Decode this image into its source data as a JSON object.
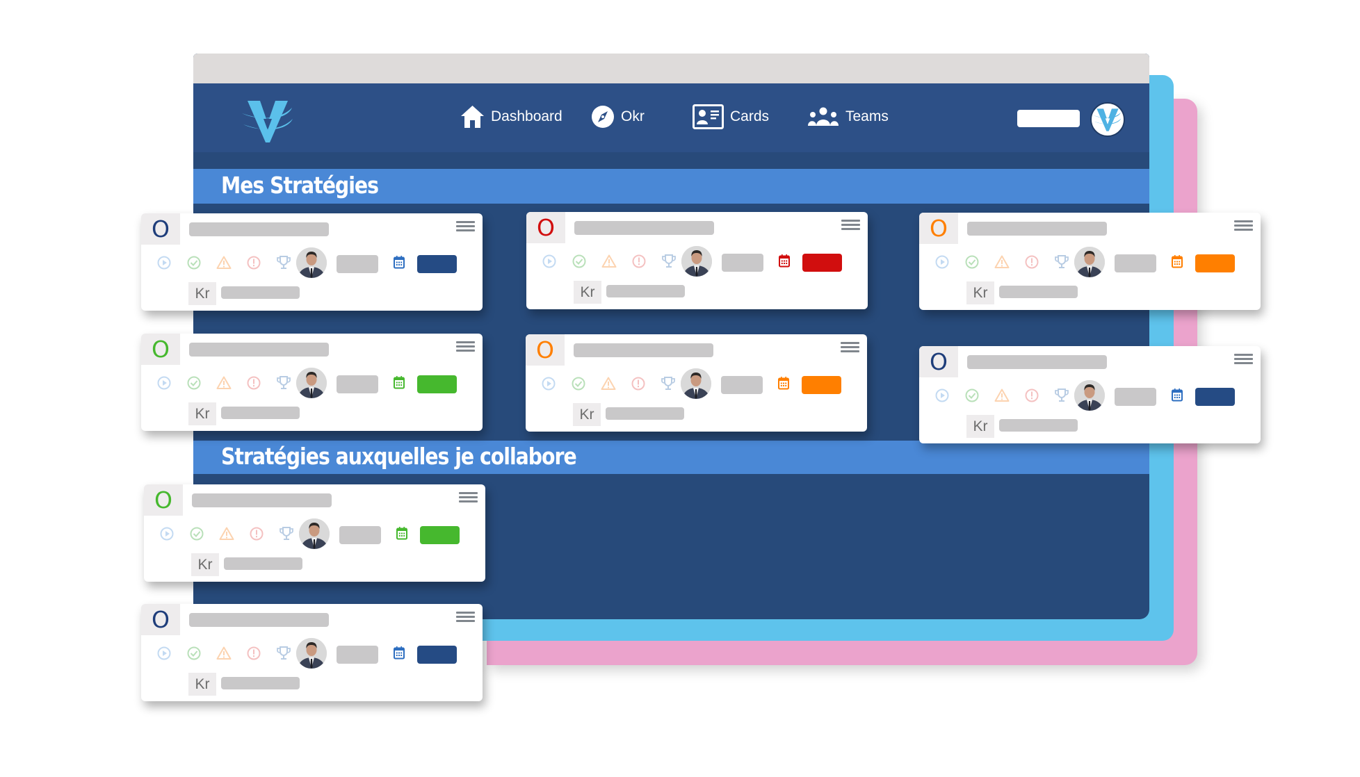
{
  "nav": {
    "items": [
      {
        "label": "Dashboard",
        "icon": "home-icon"
      },
      {
        "label": "Okr",
        "icon": "compass-icon"
      },
      {
        "label": "Cards",
        "icon": "id-card-icon"
      },
      {
        "label": "Teams",
        "icon": "users-icon"
      }
    ],
    "button_label": "",
    "logo": "v-logo"
  },
  "sections": [
    {
      "title": "Mes Stratégies"
    },
    {
      "title": "Stratégies auxquelles je collabore"
    }
  ],
  "card_labels": {
    "objective": "O",
    "key_result": "Kr"
  },
  "colors": {
    "navy": "#254B84",
    "red": "#D10E0E",
    "orange": "#FF7F00",
    "green": "#46B82E",
    "calendar_navy": "#2D6EC0"
  },
  "card_icons": [
    "play-circle-icon",
    "check-circle-icon",
    "warning-icon",
    "alert-circle-icon",
    "trophy-icon"
  ],
  "cards": [
    {
      "section": 0,
      "status": "navy"
    },
    {
      "section": 0,
      "status": "red"
    },
    {
      "section": 0,
      "status": "orange"
    },
    {
      "section": 0,
      "status": "green"
    },
    {
      "section": 0,
      "status": "orange"
    },
    {
      "section": 0,
      "status": "navy"
    },
    {
      "section": 1,
      "status": "green"
    },
    {
      "section": 1,
      "status": "navy"
    }
  ]
}
